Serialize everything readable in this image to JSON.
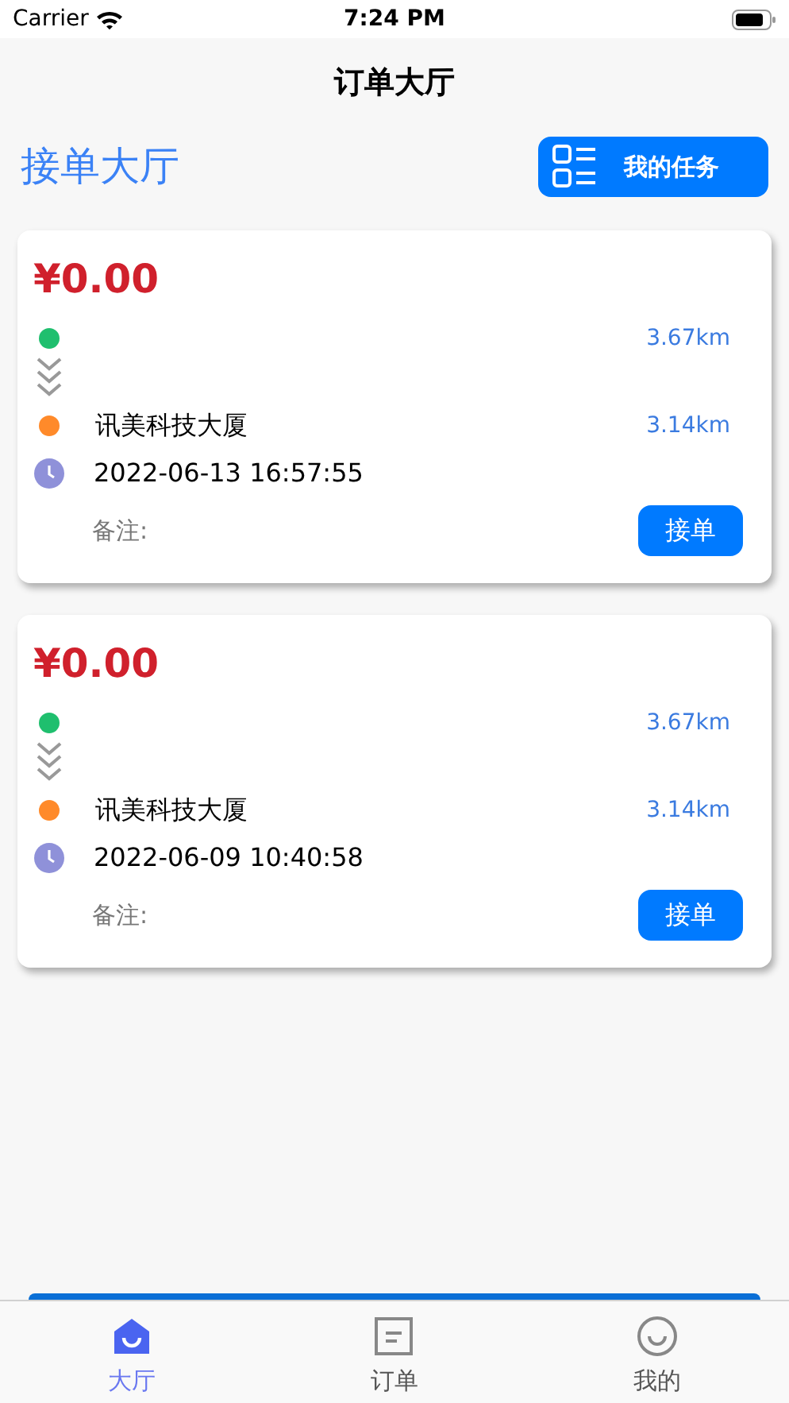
{
  "status_bar": {
    "carrier": "Carrier",
    "time": "7:24 PM"
  },
  "nav": {
    "title": "订单大厅"
  },
  "header": {
    "title": "接单大厅",
    "button": "我的任务"
  },
  "orders": [
    {
      "price": "¥0.00",
      "start_distance": "3.67km",
      "destination": "讯美科技大厦",
      "destination_distance": "3.14km",
      "time": "2022-06-13 16:57:55",
      "remark_label": "备注:",
      "action": "接单"
    },
    {
      "price": "¥0.00",
      "start_distance": "3.67km",
      "destination": "讯美科技大厦",
      "destination_distance": "3.14km",
      "time": "2022-06-09 10:40:58",
      "remark_label": "备注:",
      "action": "接单"
    }
  ],
  "tabs": [
    {
      "kind": "home",
      "label": "大厅",
      "selected": true
    },
    {
      "kind": "orders",
      "label": "订单",
      "selected": false
    },
    {
      "kind": "me",
      "label": "我的",
      "selected": false
    }
  ]
}
